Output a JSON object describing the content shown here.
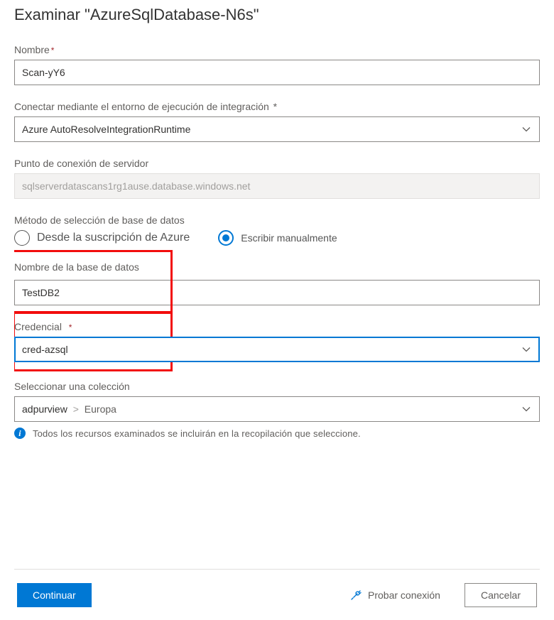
{
  "header": {
    "title": "Examinar \"AzureSqlDatabase-N6s\""
  },
  "fields": {
    "name": {
      "label": "Nombre",
      "value": "Scan-yY6"
    },
    "runtime": {
      "label": "Conectar mediante el entorno de ejecución de integración",
      "value": "Azure AutoResolveIntegrationRuntime"
    },
    "endpoint": {
      "label": "Punto de conexión de servidor",
      "value": "sqlserverdatascans1rg1ause.database.windows.net"
    },
    "dbmethod": {
      "label": "Método de selección de base de datos",
      "opt_subscription": "Desde la suscripción de Azure",
      "opt_manual": "Escribir manualmente",
      "selected": "manual"
    },
    "dbname": {
      "label": "Nombre de la base de datos",
      "value": "TestDB2"
    },
    "credential": {
      "label": "Credencial",
      "value": "cred-azsql"
    },
    "collection": {
      "label": "Seleccionar una colección",
      "root": "adpurview",
      "child": "Europa"
    },
    "info": "Todos los recursos examinados se incluirán en la recopilación que seleccione."
  },
  "footer": {
    "continue": "Continuar",
    "test": "Probar conexión",
    "cancel": "Cancelar"
  }
}
